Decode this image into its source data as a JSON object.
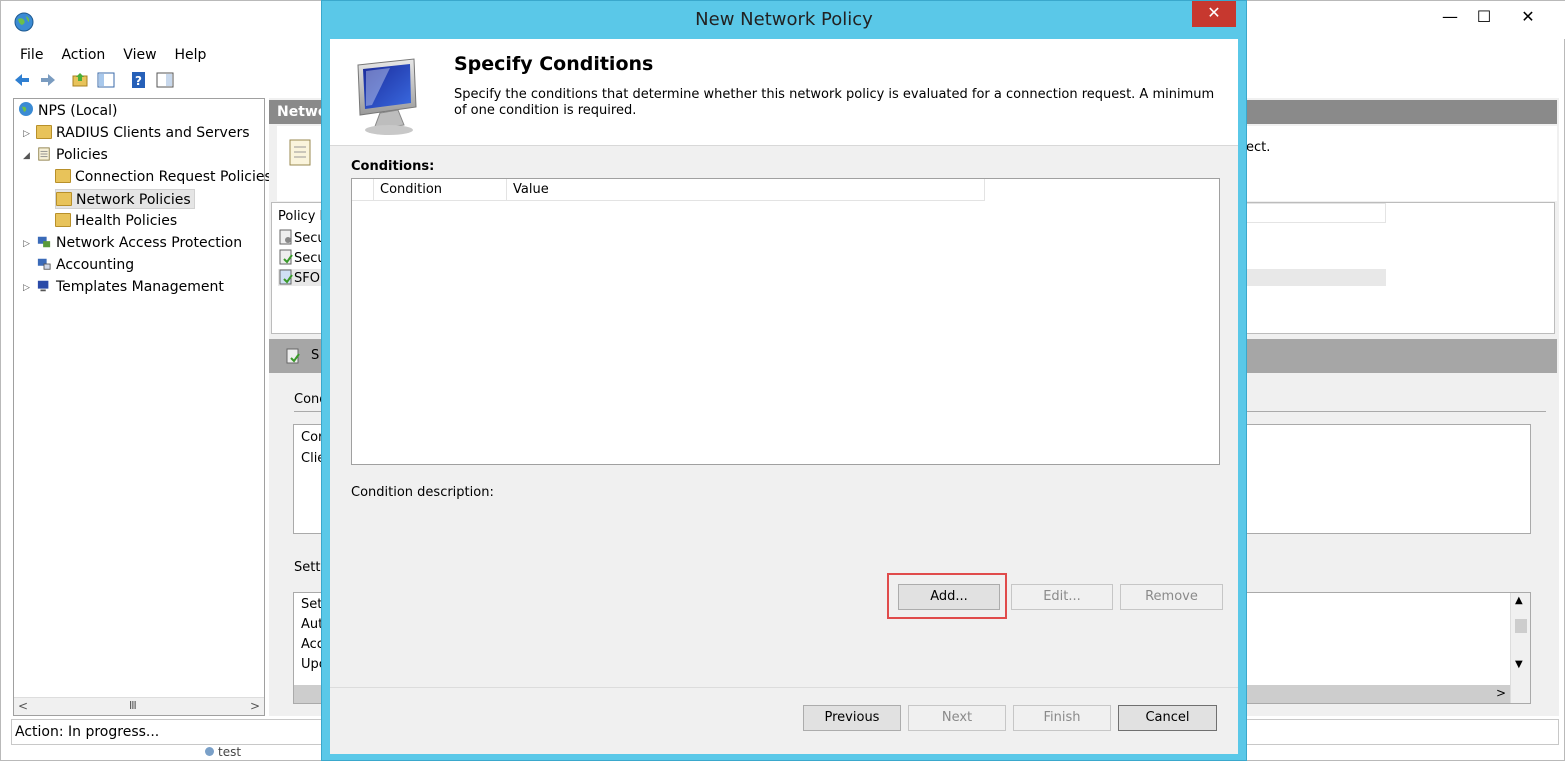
{
  "mmc": {
    "menu": [
      "File",
      "Action",
      "View",
      "Help"
    ],
    "window_controls": {
      "minimize": "—",
      "maximize": "☐",
      "close": "✕"
    },
    "tree": {
      "root": "NPS (Local)",
      "items": [
        {
          "label": "RADIUS Clients and Servers"
        },
        {
          "label": "Policies"
        },
        {
          "label": "Connection Request Policies"
        },
        {
          "label": "Network Policies"
        },
        {
          "label": "Health Policies"
        },
        {
          "label": "Network Access Protection"
        },
        {
          "label": "Accounting"
        },
        {
          "label": "Templates Management"
        }
      ],
      "hscroll_thumb": "III"
    },
    "right": {
      "header_partial": "Netwo",
      "desc_partial": "ect.",
      "policy_col_partial": "Policy N",
      "rows_partial": [
        "Secu",
        "Secu",
        "SFO"
      ],
      "band_partial": "S",
      "conditions_partial": "Cond",
      "conditions_rows_partial": [
        "Cor",
        "Clie"
      ],
      "settings_partial": "Setti",
      "settings_rows_partial": [
        "Set",
        "Aut",
        "Acc",
        "Upc"
      ]
    },
    "status": "Action:  In progress...",
    "behind_text": "test"
  },
  "dialog": {
    "title": "New Network Policy",
    "close": "✕",
    "header_title": "Specify Conditions",
    "header_desc": "Specify the conditions that determine whether this network policy is evaluated for a connection request. A minimum of one condition is required.",
    "conditions_label": "Conditions:",
    "columns": [
      "Condition",
      "Value"
    ],
    "condition_description_label": "Condition description:",
    "buttons": {
      "add": "Add...",
      "edit": "Edit...",
      "remove": "Remove",
      "previous": "Previous",
      "next": "Next",
      "finish": "Finish",
      "cancel": "Cancel"
    }
  }
}
